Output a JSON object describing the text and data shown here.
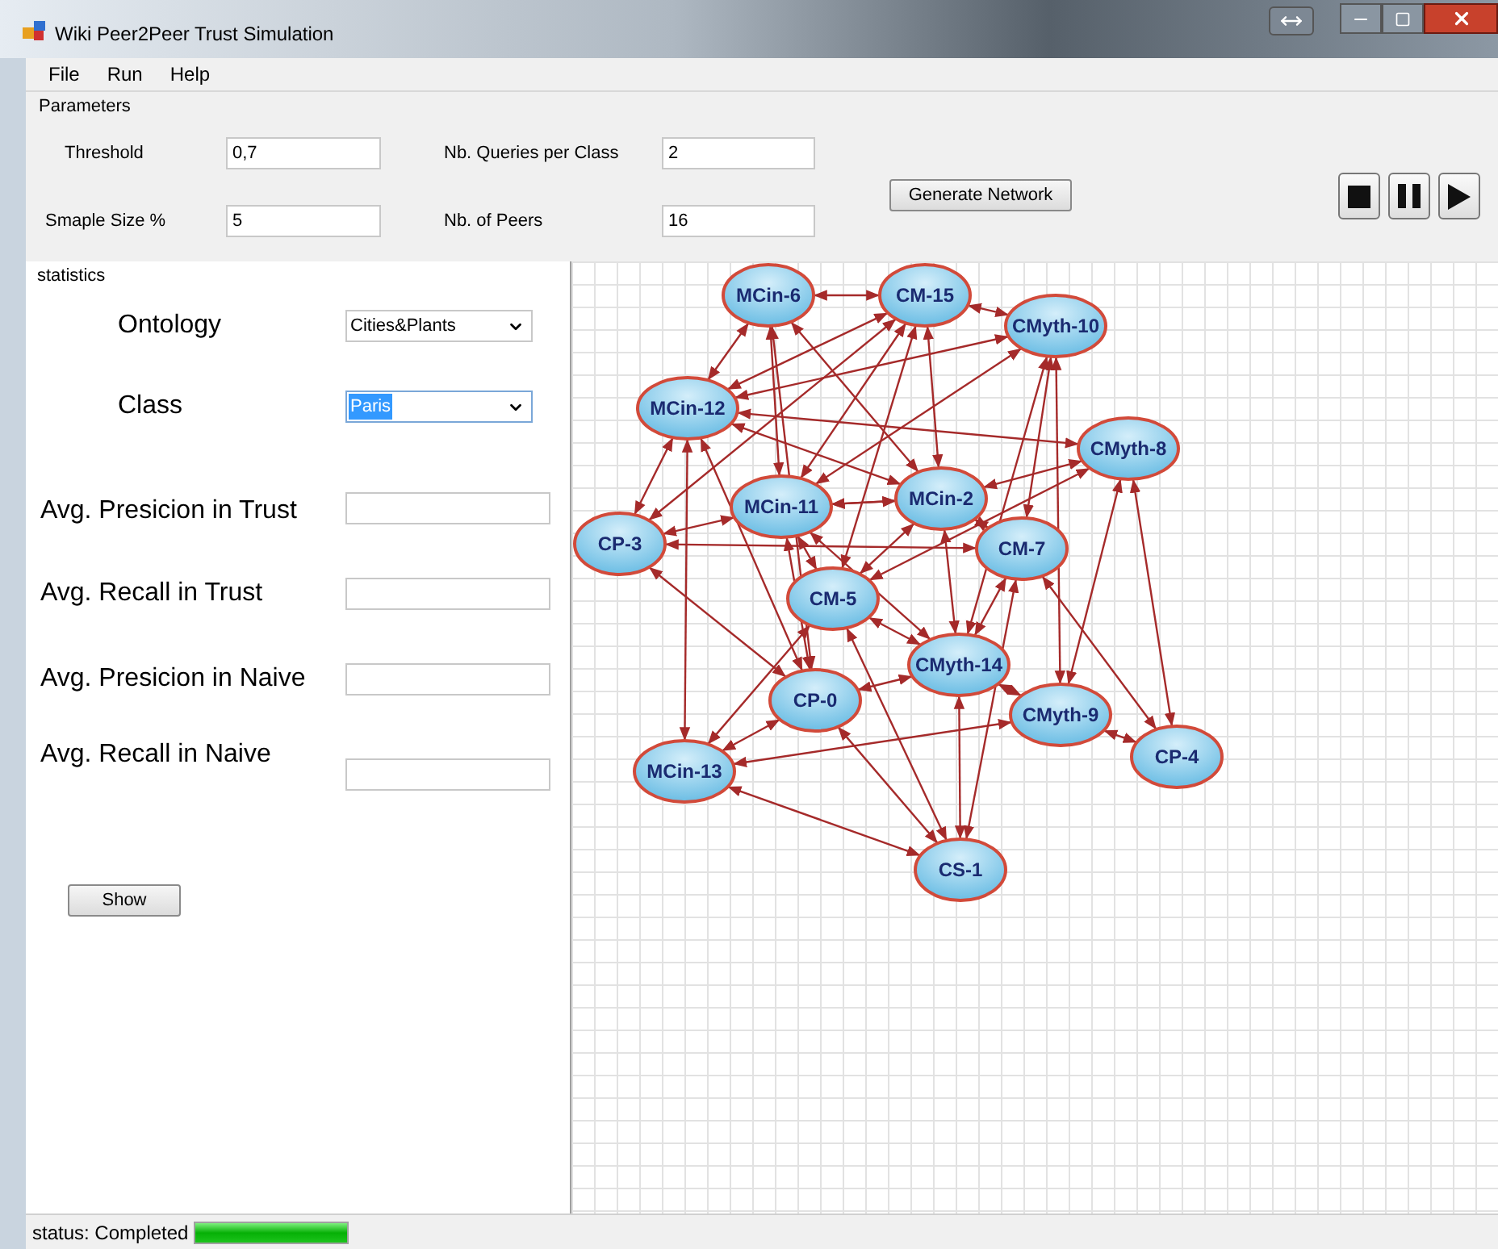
{
  "window": {
    "title": "Wiki Peer2Peer Trust Simulation"
  },
  "menu": [
    "File",
    "Run",
    "Help"
  ],
  "parameters": {
    "title": "Parameters",
    "fields": [
      {
        "label": "Threshold",
        "value": "0,7"
      },
      {
        "label": "Nb. Queries per Class",
        "value": "2"
      },
      {
        "label": "Smaple Size %",
        "value": "5"
      },
      {
        "label": "Nb. of Peers",
        "value": "16"
      }
    ],
    "generate_button": "Generate Network"
  },
  "playback": [
    {
      "kind": "stop"
    },
    {
      "kind": "pause"
    },
    {
      "kind": "play"
    }
  ],
  "statistics": {
    "title": "statistics",
    "dropdowns": [
      {
        "label": "Ontology",
        "value": "Cities&Plants",
        "highlighted": false
      },
      {
        "label": "Class",
        "value": "Paris",
        "highlighted": true
      }
    ],
    "metrics": [
      "Avg. Presicion in Trust",
      "Avg. Recall in Trust",
      "Avg. Presicion in Naive",
      "Avg. Recall in Naive"
    ],
    "show_button": "Show"
  },
  "graph": {
    "nodes": [
      {
        "label": "MCin-6"
      },
      {
        "label": "CM-15"
      },
      {
        "label": "CMyth-10"
      },
      {
        "label": "MCin-12"
      },
      {
        "label": "CMyth-8"
      },
      {
        "label": "MCin-11"
      },
      {
        "label": "MCin-2"
      },
      {
        "label": "CP-3"
      },
      {
        "label": "CM-7"
      },
      {
        "label": "CM-5"
      },
      {
        "label": "CMyth-14"
      },
      {
        "label": "CP-0"
      },
      {
        "label": "CMyth-9"
      },
      {
        "label": "CP-4"
      },
      {
        "label": "MCin-13"
      },
      {
        "label": "CS-1"
      }
    ]
  },
  "status_bar": {
    "text": "status: Completed",
    "level": 1
  }
}
